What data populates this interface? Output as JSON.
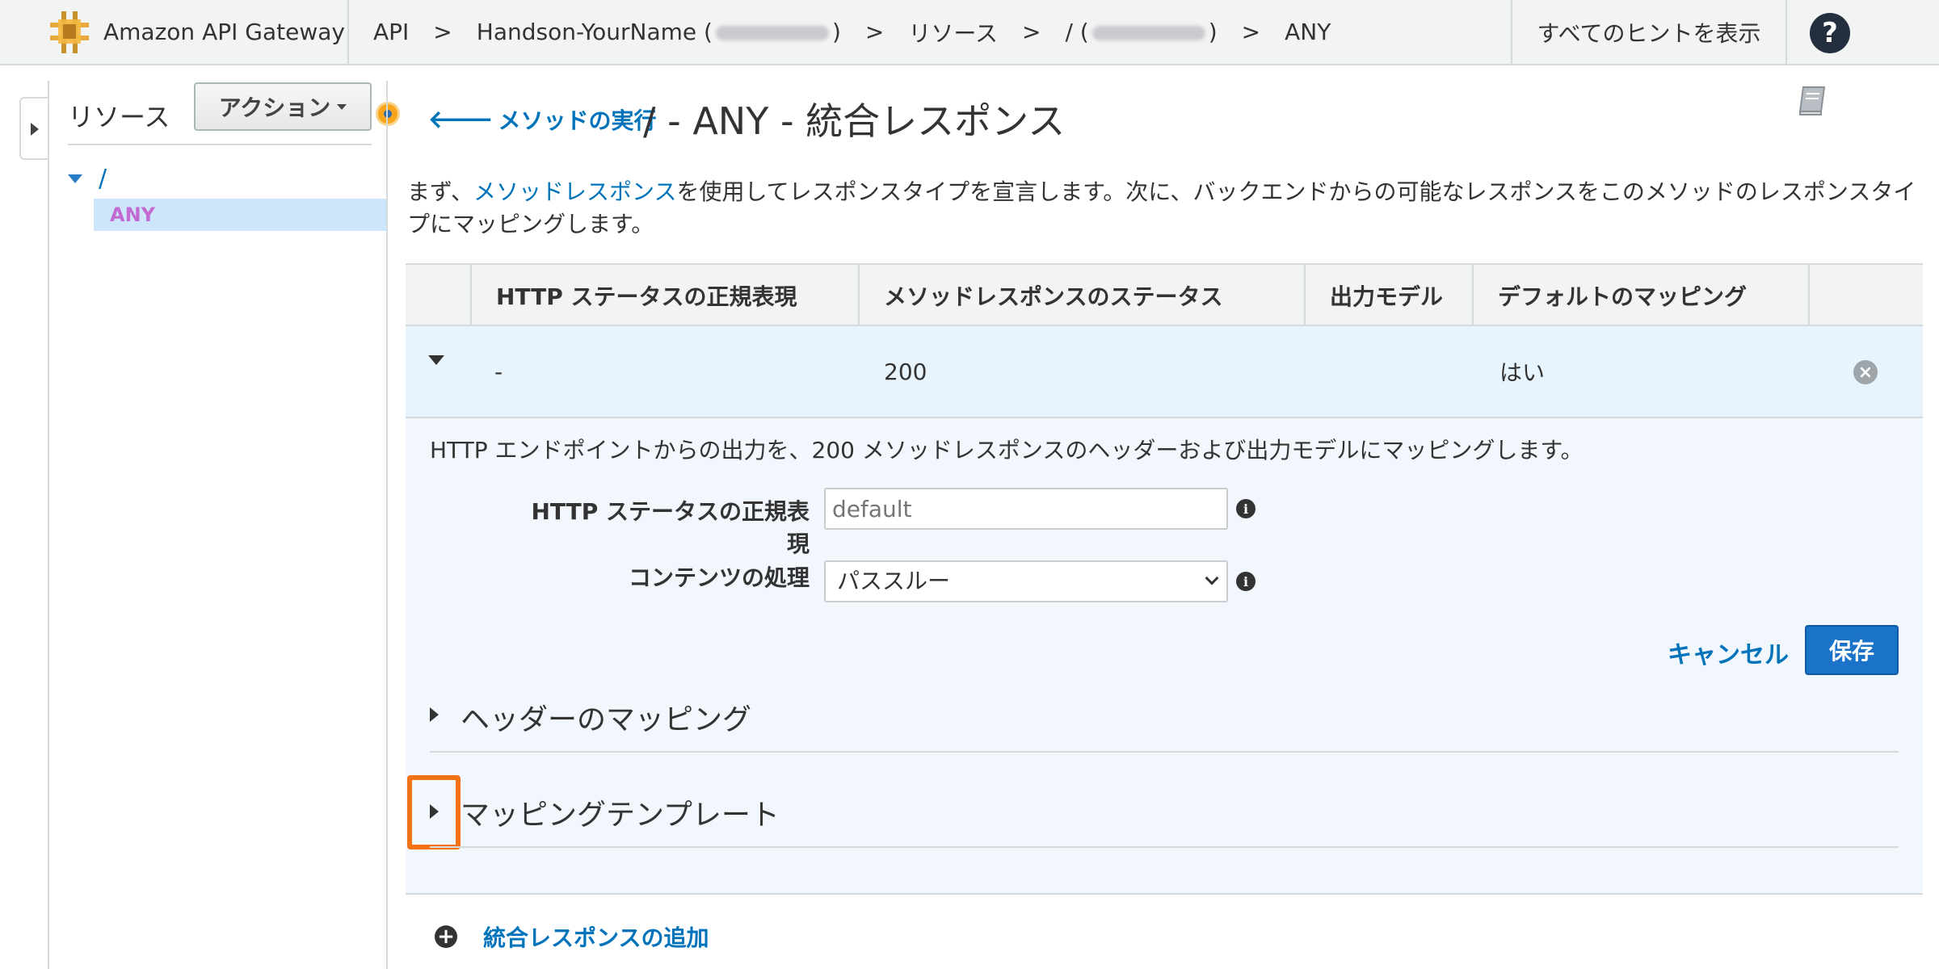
{
  "topbar": {
    "brand": "Amazon API Gateway",
    "breadcrumbs": {
      "api": "API",
      "sep": ">",
      "api_name_prefix": "Handson-YourName (",
      "api_name_suffix": ")",
      "resources": "リソース",
      "resource_prefix": "/ (",
      "resource_suffix": ")",
      "method": "ANY"
    },
    "hints": "すべてのヒントを表示",
    "help": "?"
  },
  "resources": {
    "title": "リソース",
    "action_button": "アクション",
    "root": "/",
    "selected": "ANY"
  },
  "main": {
    "back_link": "メソッドの実行",
    "title": "/ - ANY - 統合レスポンス",
    "intro_before": "まず、",
    "intro_link": "メソッドレスポンス",
    "intro_after": "を使用してレスポンスタイプを宣言します。次に、バックエンドからの可能なレスポンスをこのメソッドのレスポンスタイプにマッピングします。"
  },
  "table": {
    "headers": [
      "HTTP ステータスの正規表現",
      "メソッドレスポンスのステータス",
      "出力モデル",
      "デフォルトのマッピング"
    ],
    "row": {
      "regex": "-",
      "status": "200",
      "model": "",
      "default": "はい"
    }
  },
  "detail": {
    "description": "HTTP エンドポイントからの出力を、200 メソッドレスポンスのヘッダーおよび出力モデルにマッピングします。",
    "regex_label": "HTTP ステータスの正規表現",
    "regex_placeholder": "default",
    "content_label": "コンテンツの処理",
    "content_value": "パススルー",
    "cancel": "キャンセル",
    "save": "保存",
    "header_mapping": "ヘッダーのマッピング",
    "mapping_templates": "マッピングテンプレート"
  },
  "add_response": "統合レスポンスの追加",
  "colors": {
    "link": "#0073bb",
    "primary_button": "#1a73c8",
    "highlight": "#f47216",
    "selected_row": "#e8f4fd"
  }
}
